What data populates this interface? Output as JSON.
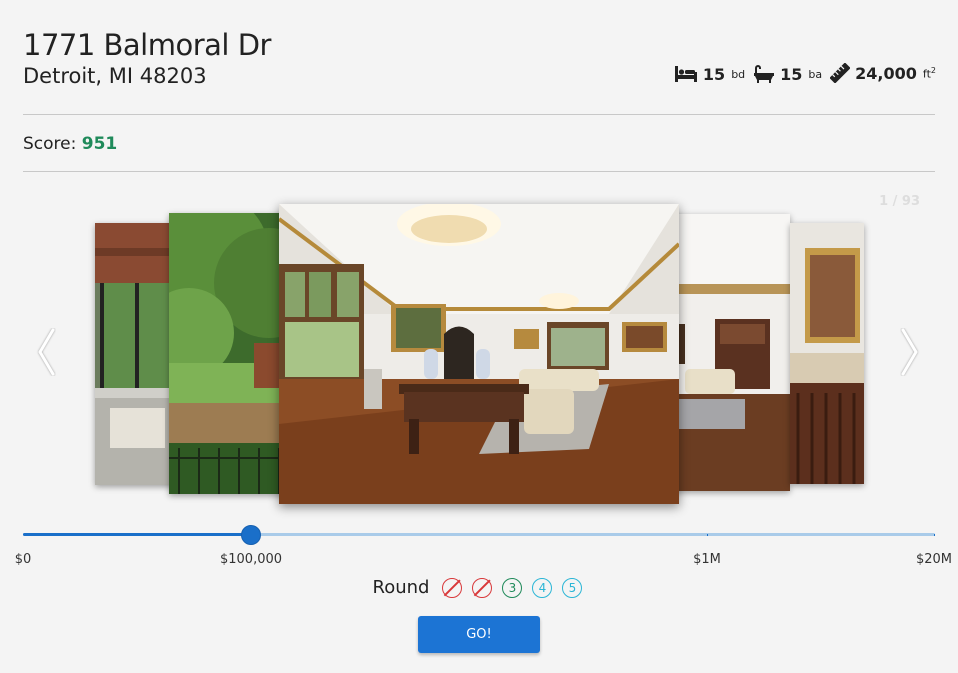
{
  "property": {
    "street": "1771 Balmoral Dr",
    "city_line": "Detroit, MI 48203",
    "beds": "15",
    "beds_unit": "bd",
    "baths": "15",
    "baths_unit": "ba",
    "area": "24,000",
    "area_unit": "ft",
    "area_unit_sup": "2"
  },
  "icons": {
    "beds": "bed-icon",
    "baths": "bathtub-icon",
    "area": "ruler-icon",
    "prev": "chevron-left-icon",
    "next": "chevron-right-icon"
  },
  "score": {
    "label": "Score:",
    "value": "951",
    "color": "#1f8a5a"
  },
  "carousel": {
    "counter": "1 / 93",
    "current": 1,
    "total": 93
  },
  "slider": {
    "labels": [
      "$0",
      "$100,000",
      "$1M",
      "$20M"
    ],
    "value_label": "$100,000",
    "accent": "#1a6fc9"
  },
  "rounds": {
    "label": "Round",
    "badges": [
      {
        "text": "",
        "state": "lost"
      },
      {
        "text": "",
        "state": "lost"
      },
      {
        "text": "3",
        "state": "done"
      },
      {
        "text": "4",
        "state": "next"
      },
      {
        "text": "5",
        "state": "next"
      }
    ]
  },
  "go_button": {
    "label": "GO!",
    "color": "#1c74d4"
  }
}
